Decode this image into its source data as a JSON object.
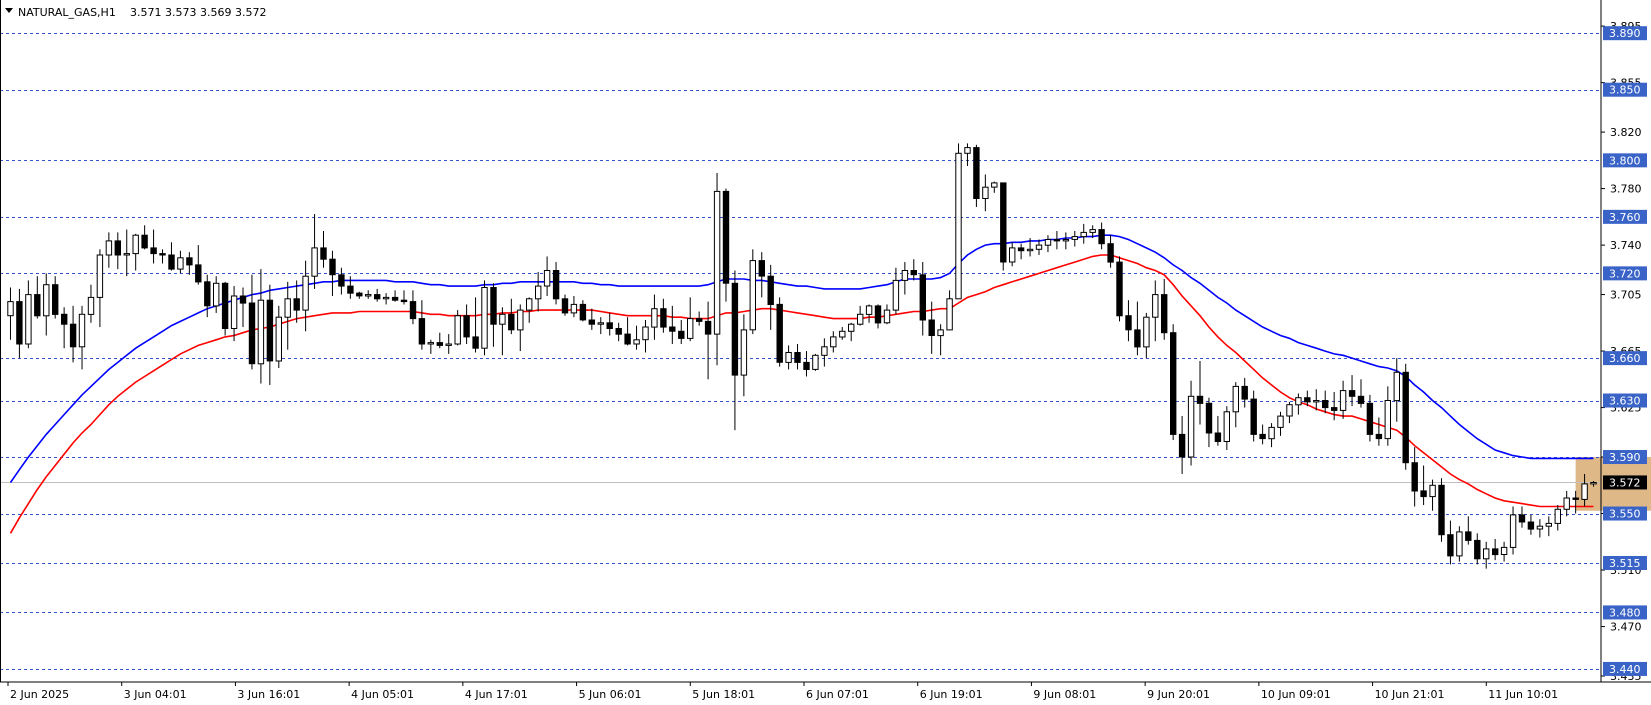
{
  "header": {
    "symbol": "NATURAL_GAS,H1",
    "ohlc": "3.571 3.573 3.569 3.572"
  },
  "colors": {
    "bull": "#ffffff",
    "bear": "#000000",
    "ma_fast": "#ff0000",
    "ma_slow": "#0000ff",
    "level_line": "#3355cc",
    "level_tag": "#3a63c8",
    "zone_fill": "#deb887",
    "price_tag": "#000000"
  },
  "chart_data": {
    "type": "candlestick",
    "ylim": [
      3.435,
      3.905
    ],
    "y_ticks": [
      "3.895",
      "3.855",
      "3.820",
      "3.780",
      "3.740",
      "3.705",
      "3.665",
      "3.625",
      "3.590",
      "3.550",
      "3.510",
      "3.470",
      "3.435"
    ],
    "x_labels": [
      "2 Jun 2025",
      "3 Jun 04:01",
      "3 Jun 16:01",
      "4 Jun 05:01",
      "4 Jun 17:01",
      "5 Jun 06:01",
      "5 Jun 18:01",
      "6 Jun 07:01",
      "6 Jun 19:01",
      "9 Jun 08:01",
      "9 Jun 20:01",
      "10 Jun 09:01",
      "10 Jun 21:01",
      "11 Jun 10:01"
    ],
    "levels": [
      3.89,
      3.85,
      3.8,
      3.76,
      3.72,
      3.66,
      3.63,
      3.59,
      3.55,
      3.515,
      3.48,
      3.44
    ],
    "level_labels": [
      "3.890",
      "3.850",
      "3.800",
      "3.760",
      "3.720",
      "3.660",
      "3.630",
      "3.590",
      "3.550",
      "3.515",
      "3.480",
      "3.440"
    ],
    "current_price": 3.572,
    "current_price_label": "3.572",
    "zone": {
      "from_bar": 175,
      "to_bar": 207,
      "low": 3.552,
      "high": 3.59
    },
    "ohlc": [
      [
        3.69,
        3.71,
        3.673,
        3.7
      ],
      [
        3.7,
        3.709,
        3.66,
        3.67
      ],
      [
        3.67,
        3.715,
        3.667,
        3.705
      ],
      [
        3.705,
        3.718,
        3.688,
        3.69
      ],
      [
        3.69,
        3.72,
        3.676,
        3.712
      ],
      [
        3.712,
        3.718,
        3.688,
        3.691
      ],
      [
        3.691,
        3.696,
        3.667,
        3.684
      ],
      [
        3.684,
        3.697,
        3.657,
        3.668
      ],
      [
        3.668,
        3.697,
        3.652,
        3.691
      ],
      [
        3.691,
        3.712,
        3.685,
        3.703
      ],
      [
        3.703,
        3.737,
        3.682,
        3.733
      ],
      [
        3.733,
        3.749,
        3.724,
        3.743
      ],
      [
        3.743,
        3.749,
        3.723,
        3.733
      ],
      [
        3.733,
        3.751,
        3.718,
        3.734
      ],
      [
        3.734,
        3.748,
        3.722,
        3.747
      ],
      [
        3.747,
        3.754,
        3.737,
        3.738
      ],
      [
        3.738,
        3.751,
        3.727,
        3.734
      ],
      [
        3.734,
        3.737,
        3.727,
        3.733
      ],
      [
        3.733,
        3.742,
        3.722,
        3.723
      ],
      [
        3.723,
        3.736,
        3.72,
        3.731
      ],
      [
        3.731,
        3.735,
        3.719,
        3.726
      ],
      [
        3.726,
        3.74,
        3.712,
        3.714
      ],
      [
        3.714,
        3.719,
        3.689,
        3.697
      ],
      [
        3.697,
        3.718,
        3.692,
        3.713
      ],
      [
        3.713,
        3.714,
        3.676,
        3.681
      ],
      [
        3.681,
        3.711,
        3.672,
        3.704
      ],
      [
        3.704,
        3.71,
        3.682,
        3.699
      ],
      [
        3.699,
        3.719,
        3.652,
        3.656
      ],
      [
        3.656,
        3.723,
        3.642,
        3.701
      ],
      [
        3.701,
        3.712,
        3.641,
        3.658
      ],
      [
        3.658,
        3.697,
        3.653,
        3.689
      ],
      [
        3.689,
        3.714,
        3.666,
        3.702
      ],
      [
        3.702,
        3.715,
        3.685,
        3.694
      ],
      [
        3.694,
        3.729,
        3.679,
        3.718
      ],
      [
        3.718,
        3.762,
        3.709,
        3.738
      ],
      [
        3.738,
        3.75,
        3.724,
        3.73
      ],
      [
        3.73,
        3.736,
        3.704,
        3.719
      ],
      [
        3.719,
        3.724,
        3.705,
        3.711
      ],
      [
        3.711,
        3.718,
        3.702,
        3.706
      ],
      [
        3.706,
        3.707,
        3.702,
        3.704
      ],
      [
        3.704,
        3.708,
        3.702,
        3.705
      ],
      [
        3.705,
        3.709,
        3.7,
        3.702
      ],
      [
        3.702,
        3.706,
        3.698,
        3.703
      ],
      [
        3.703,
        3.708,
        3.7,
        3.701
      ],
      [
        3.701,
        3.708,
        3.698,
        3.7
      ],
      [
        3.7,
        3.708,
        3.684,
        3.688
      ],
      [
        3.688,
        3.701,
        3.666,
        3.67
      ],
      [
        3.67,
        3.673,
        3.663,
        3.671
      ],
      [
        3.671,
        3.678,
        3.667,
        3.669
      ],
      [
        3.669,
        3.677,
        3.663,
        3.67
      ],
      [
        3.67,
        3.694,
        3.669,
        3.69
      ],
      [
        3.69,
        3.698,
        3.67,
        3.675
      ],
      [
        3.675,
        3.703,
        3.664,
        3.667
      ],
      [
        3.667,
        3.715,
        3.662,
        3.71
      ],
      [
        3.71,
        3.713,
        3.668,
        3.684
      ],
      [
        3.684,
        3.696,
        3.662,
        3.691
      ],
      [
        3.691,
        3.702,
        3.677,
        3.68
      ],
      [
        3.68,
        3.698,
        3.665,
        3.694
      ],
      [
        3.694,
        3.703,
        3.685,
        3.702
      ],
      [
        3.702,
        3.721,
        3.693,
        3.711
      ],
      [
        3.711,
        3.732,
        3.704,
        3.722
      ],
      [
        3.722,
        3.728,
        3.698,
        3.702
      ],
      [
        3.702,
        3.705,
        3.69,
        3.692
      ],
      [
        3.692,
        3.704,
        3.689,
        3.698
      ],
      [
        3.698,
        3.701,
        3.686,
        3.687
      ],
      [
        3.687,
        3.695,
        3.68,
        3.684
      ],
      [
        3.684,
        3.689,
        3.677,
        3.685
      ],
      [
        3.685,
        3.692,
        3.676,
        3.681
      ],
      [
        3.681,
        3.685,
        3.672,
        3.677
      ],
      [
        3.677,
        3.689,
        3.669,
        3.67
      ],
      [
        3.67,
        3.683,
        3.666,
        3.673
      ],
      [
        3.673,
        3.687,
        3.664,
        3.682
      ],
      [
        3.682,
        3.705,
        3.673,
        3.695
      ],
      [
        3.695,
        3.702,
        3.678,
        3.682
      ],
      [
        3.682,
        3.697,
        3.67,
        3.679
      ],
      [
        3.679,
        3.687,
        3.67,
        3.674
      ],
      [
        3.674,
        3.703,
        3.672,
        3.688
      ],
      [
        3.688,
        3.693,
        3.683,
        3.686
      ],
      [
        3.686,
        3.7,
        3.645,
        3.677
      ],
      [
        3.677,
        3.791,
        3.655,
        3.778
      ],
      [
        3.778,
        3.78,
        3.7,
        3.713
      ],
      [
        3.713,
        3.722,
        3.609,
        3.648
      ],
      [
        3.648,
        3.691,
        3.633,
        3.68
      ],
      [
        3.68,
        3.737,
        3.677,
        3.729
      ],
      [
        3.729,
        3.735,
        3.703,
        3.718
      ],
      [
        3.718,
        3.726,
        3.68,
        3.698
      ],
      [
        3.698,
        3.703,
        3.654,
        3.657
      ],
      [
        3.657,
        3.669,
        3.652,
        3.664
      ],
      [
        3.664,
        3.67,
        3.652,
        3.657
      ],
      [
        3.657,
        3.665,
        3.647,
        3.652
      ],
      [
        3.652,
        3.663,
        3.651,
        3.662
      ],
      [
        3.662,
        3.674,
        3.654,
        3.668
      ],
      [
        3.668,
        3.679,
        3.664,
        3.675
      ],
      [
        3.675,
        3.682,
        3.673,
        3.679
      ],
      [
        3.679,
        3.685,
        3.672,
        3.684
      ],
      [
        3.684,
        3.697,
        3.683,
        3.691
      ],
      [
        3.691,
        3.698,
        3.685,
        3.697
      ],
      [
        3.697,
        3.698,
        3.681,
        3.685
      ],
      [
        3.685,
        3.698,
        3.684,
        3.694
      ],
      [
        3.694,
        3.724,
        3.691,
        3.715
      ],
      [
        3.715,
        3.728,
        3.705,
        3.722
      ],
      [
        3.722,
        3.73,
        3.715,
        3.719
      ],
      [
        3.719,
        3.728,
        3.676,
        3.687
      ],
      [
        3.687,
        3.7,
        3.663,
        3.676
      ],
      [
        3.676,
        3.684,
        3.662,
        3.68
      ],
      [
        3.68,
        3.708,
        3.68,
        3.702
      ],
      [
        3.702,
        3.812,
        3.702,
        3.805
      ],
      [
        3.805,
        3.812,
        3.796,
        3.809
      ],
      [
        3.809,
        3.811,
        3.767,
        3.773
      ],
      [
        3.773,
        3.79,
        3.764,
        3.781
      ],
      [
        3.781,
        3.785,
        3.777,
        3.784
      ],
      [
        3.784,
        3.753,
        3.722,
        3.728
      ],
      [
        3.728,
        3.742,
        3.725,
        3.738
      ],
      [
        3.738,
        3.741,
        3.73,
        3.736
      ],
      [
        3.736,
        3.745,
        3.732,
        3.737
      ],
      [
        3.737,
        3.744,
        3.733,
        3.74
      ],
      [
        3.74,
        3.747,
        3.735,
        3.744
      ],
      [
        3.744,
        3.75,
        3.737,
        3.743
      ],
      [
        3.743,
        3.749,
        3.737,
        3.744
      ],
      [
        3.744,
        3.75,
        3.739,
        3.746
      ],
      [
        3.746,
        3.755,
        3.741,
        3.749
      ],
      [
        3.749,
        3.754,
        3.745,
        3.751
      ],
      [
        3.751,
        3.756,
        3.737,
        3.741
      ],
      [
        3.741,
        3.747,
        3.724,
        3.728
      ],
      [
        3.728,
        3.732,
        3.686,
        3.69
      ],
      [
        3.69,
        3.701,
        3.672,
        3.68
      ],
      [
        3.68,
        3.7,
        3.662,
        3.668
      ],
      [
        3.668,
        3.692,
        3.66,
        3.689
      ],
      [
        3.689,
        3.715,
        3.672,
        3.705
      ],
      [
        3.705,
        3.716,
        3.673,
        3.678
      ],
      [
        3.678,
        3.684,
        3.602,
        3.606
      ],
      [
        3.606,
        3.619,
        3.578,
        3.59
      ],
      [
        3.59,
        3.644,
        3.584,
        3.633
      ],
      [
        3.633,
        3.658,
        3.613,
        3.628
      ],
      [
        3.628,
        3.632,
        3.597,
        3.607
      ],
      [
        3.607,
        3.619,
        3.598,
        3.601
      ],
      [
        3.601,
        3.626,
        3.595,
        3.622
      ],
      [
        3.622,
        3.643,
        3.611,
        3.64
      ],
      [
        3.64,
        3.646,
        3.625,
        3.631
      ],
      [
        3.631,
        3.637,
        3.601,
        3.606
      ],
      [
        3.606,
        3.613,
        3.599,
        3.603
      ],
      [
        3.603,
        3.614,
        3.597,
        3.611
      ],
      [
        3.611,
        3.622,
        3.605,
        3.619
      ],
      [
        3.619,
        3.629,
        3.614,
        3.627
      ],
      [
        3.627,
        3.635,
        3.62,
        3.632
      ],
      [
        3.632,
        3.637,
        3.626,
        3.629
      ],
      [
        3.629,
        3.638,
        3.623,
        3.63
      ],
      [
        3.63,
        3.637,
        3.621,
        3.625
      ],
      [
        3.625,
        3.636,
        3.616,
        3.623
      ],
      [
        3.623,
        3.644,
        3.617,
        3.637
      ],
      [
        3.637,
        3.648,
        3.626,
        3.633
      ],
      [
        3.633,
        3.645,
        3.625,
        3.628
      ],
      [
        3.628,
        3.634,
        3.601,
        3.606
      ],
      [
        3.606,
        3.618,
        3.598,
        3.603
      ],
      [
        3.603,
        3.64,
        3.598,
        3.63
      ],
      [
        3.63,
        3.66,
        3.615,
        3.65
      ],
      [
        3.65,
        3.656,
        3.581,
        3.586
      ],
      [
        3.586,
        3.597,
        3.555,
        3.566
      ],
      [
        3.566,
        3.584,
        3.556,
        3.562
      ],
      [
        3.562,
        3.574,
        3.552,
        3.57
      ],
      [
        3.57,
        3.575,
        3.53,
        3.535
      ],
      [
        3.535,
        3.545,
        3.514,
        3.52
      ],
      [
        3.52,
        3.541,
        3.516,
        3.537
      ],
      [
        3.537,
        3.548,
        3.528,
        3.531
      ],
      [
        3.531,
        3.536,
        3.514,
        3.518
      ],
      [
        3.518,
        3.53,
        3.511,
        3.525
      ],
      [
        3.525,
        3.532,
        3.517,
        3.521
      ],
      [
        3.521,
        3.53,
        3.516,
        3.526
      ],
      [
        3.526,
        3.555,
        3.521,
        3.549
      ],
      [
        3.549,
        3.555,
        3.54,
        3.544
      ],
      [
        3.544,
        3.549,
        3.535,
        3.539
      ],
      [
        3.539,
        3.546,
        3.533,
        3.541
      ],
      [
        3.541,
        3.548,
        3.534,
        3.543
      ],
      [
        3.543,
        3.556,
        3.538,
        3.553
      ],
      [
        3.553,
        3.566,
        3.548,
        3.561
      ],
      [
        3.561,
        3.566,
        3.55,
        3.56
      ],
      [
        3.56,
        3.578,
        3.555,
        3.571
      ],
      [
        3.571,
        3.573,
        3.569,
        3.572
      ]
    ],
    "ma_fast": [
      3.536,
      3.547,
      3.557,
      3.567,
      3.576,
      3.584,
      3.592,
      3.6,
      3.607,
      3.613,
      3.62,
      3.627,
      3.633,
      3.638,
      3.643,
      3.647,
      3.651,
      3.655,
      3.659,
      3.663,
      3.666,
      3.669,
      3.671,
      3.673,
      3.675,
      3.676,
      3.678,
      3.68,
      3.681,
      3.682,
      3.684,
      3.686,
      3.688,
      3.689,
      3.69,
      3.691,
      3.692,
      3.692,
      3.692,
      3.693,
      3.693,
      3.693,
      3.693,
      3.693,
      3.693,
      3.693,
      3.692,
      3.691,
      3.691,
      3.69,
      3.69,
      3.69,
      3.69,
      3.691,
      3.691,
      3.692,
      3.692,
      3.693,
      3.693,
      3.694,
      3.694,
      3.694,
      3.694,
      3.694,
      3.694,
      3.694,
      3.693,
      3.692,
      3.691,
      3.69,
      3.69,
      3.69,
      3.69,
      3.69,
      3.689,
      3.689,
      3.688,
      3.688,
      3.688,
      3.69,
      3.692,
      3.692,
      3.693,
      3.694,
      3.695,
      3.695,
      3.694,
      3.693,
      3.692,
      3.691,
      3.69,
      3.689,
      3.688,
      3.688,
      3.688,
      3.688,
      3.689,
      3.689,
      3.69,
      3.691,
      3.692,
      3.693,
      3.693,
      3.694,
      3.695,
      3.695,
      3.699,
      3.703,
      3.705,
      3.707,
      3.71,
      3.712,
      3.714,
      3.716,
      3.718,
      3.72,
      3.722,
      3.724,
      3.726,
      3.728,
      3.73,
      3.732,
      3.733,
      3.733,
      3.731,
      3.729,
      3.727,
      3.724,
      3.722,
      3.719,
      3.712,
      3.704,
      3.697,
      3.69,
      3.682,
      3.675,
      3.669,
      3.664,
      3.658,
      3.652,
      3.646,
      3.641,
      3.636,
      3.632,
      3.629,
      3.627,
      3.624,
      3.622,
      3.62,
      3.619,
      3.619,
      3.617,
      3.615,
      3.613,
      3.611,
      3.609,
      3.604,
      3.598,
      3.593,
      3.588,
      3.583,
      3.578,
      3.574,
      3.571,
      3.567,
      3.564,
      3.561,
      3.559,
      3.558,
      3.557,
      3.556,
      3.555,
      3.555,
      3.555,
      3.555,
      3.555,
      3.555,
      3.555
    ],
    "ma_slow": [
      3.572,
      3.581,
      3.59,
      3.598,
      3.606,
      3.613,
      3.62,
      3.627,
      3.634,
      3.64,
      3.646,
      3.652,
      3.657,
      3.662,
      3.667,
      3.671,
      3.675,
      3.679,
      3.683,
      3.686,
      3.689,
      3.692,
      3.695,
      3.697,
      3.699,
      3.701,
      3.703,
      3.705,
      3.706,
      3.708,
      3.709,
      3.71,
      3.711,
      3.712,
      3.713,
      3.714,
      3.714,
      3.715,
      3.715,
      3.715,
      3.715,
      3.715,
      3.715,
      3.714,
      3.714,
      3.714,
      3.713,
      3.712,
      3.712,
      3.711,
      3.711,
      3.711,
      3.711,
      3.712,
      3.712,
      3.713,
      3.713,
      3.714,
      3.714,
      3.714,
      3.714,
      3.714,
      3.714,
      3.714,
      3.713,
      3.713,
      3.712,
      3.712,
      3.711,
      3.711,
      3.711,
      3.711,
      3.711,
      3.711,
      3.711,
      3.711,
      3.711,
      3.711,
      3.712,
      3.714,
      3.716,
      3.716,
      3.716,
      3.715,
      3.715,
      3.714,
      3.713,
      3.712,
      3.711,
      3.711,
      3.71,
      3.709,
      3.709,
      3.709,
      3.709,
      3.709,
      3.71,
      3.711,
      3.712,
      3.714,
      3.716,
      3.716,
      3.716,
      3.716,
      3.717,
      3.72,
      3.727,
      3.733,
      3.737,
      3.74,
      3.741,
      3.741,
      3.742,
      3.742,
      3.743,
      3.743,
      3.744,
      3.744,
      3.745,
      3.745,
      3.746,
      3.746,
      3.747,
      3.747,
      3.746,
      3.744,
      3.741,
      3.738,
      3.735,
      3.731,
      3.726,
      3.722,
      3.717,
      3.713,
      3.708,
      3.703,
      3.699,
      3.694,
      3.69,
      3.686,
      3.682,
      3.679,
      3.676,
      3.674,
      3.671,
      3.669,
      3.667,
      3.665,
      3.663,
      3.662,
      3.66,
      3.658,
      3.656,
      3.654,
      3.653,
      3.651,
      3.647,
      3.641,
      3.636,
      3.63,
      3.625,
      3.619,
      3.613,
      3.608,
      3.603,
      3.599,
      3.595,
      3.593,
      3.591,
      3.59,
      3.589,
      3.589,
      3.589,
      3.589,
      3.589,
      3.589,
      3.589,
      3.589
    ]
  }
}
